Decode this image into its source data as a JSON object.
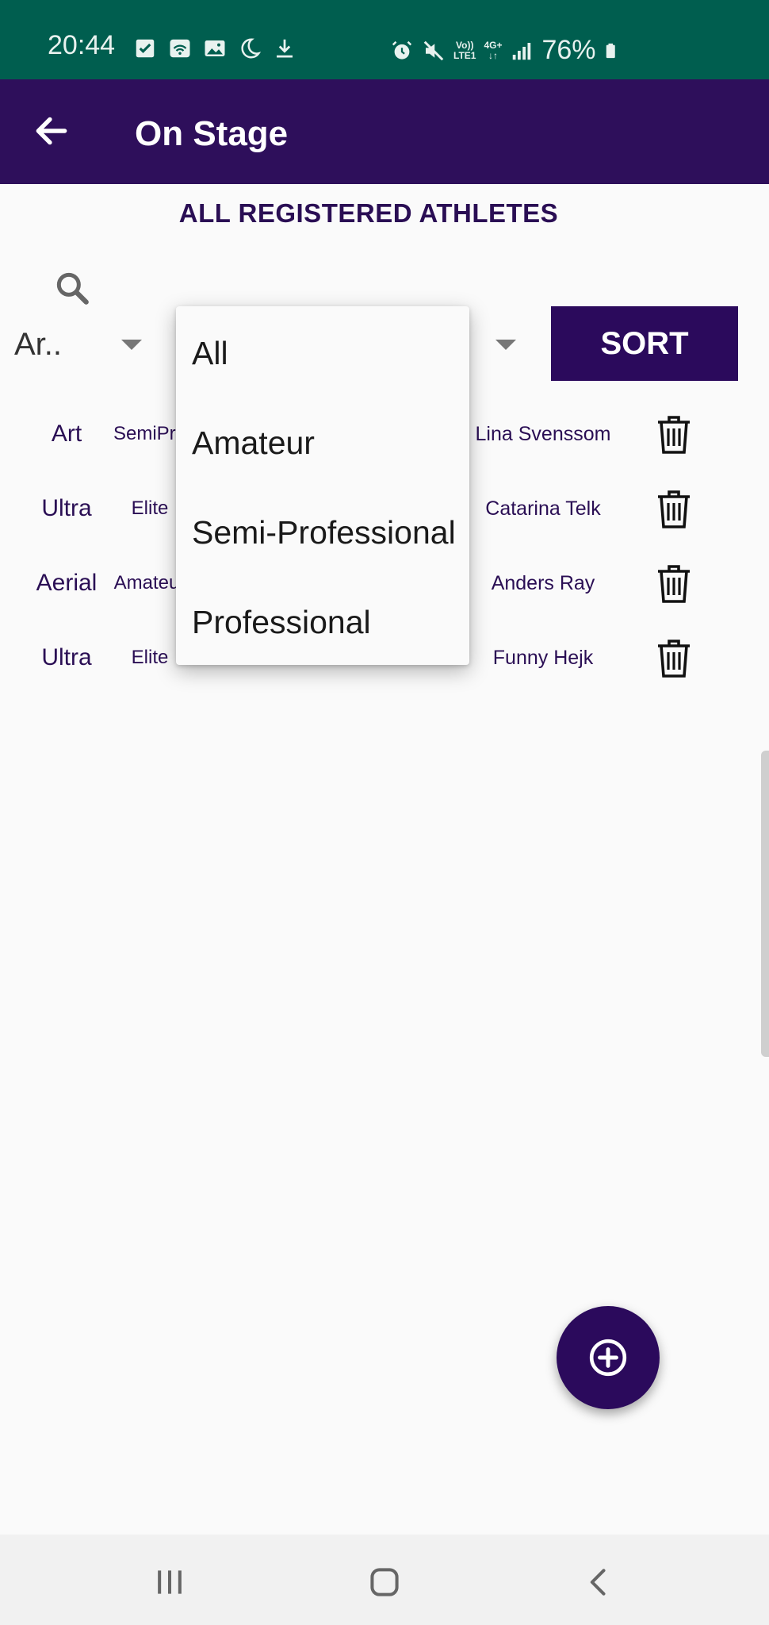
{
  "status_bar": {
    "time": "20:44",
    "network_top": "Vo))",
    "network_bottom": "LTE1",
    "data_type": "4G+",
    "battery": "76%",
    "left_icons": [
      "checkbox-icon",
      "wifi-calling-icon",
      "image-icon",
      "moon-icon",
      "download-icon"
    ],
    "right_icons": [
      "alarm-icon",
      "mute-icon",
      "signal-icon",
      "battery-icon"
    ],
    "background_color": "#005e4f"
  },
  "app_bar": {
    "title": "On Stage",
    "background_color": "#2e0f5b"
  },
  "page": {
    "heading": "ALL REGISTERED ATHLETES"
  },
  "filters": {
    "type_selected": "Ar..",
    "sort_label": "SORT"
  },
  "dropdown": {
    "options": [
      "All",
      "Amateur",
      "Semi-Professional",
      "Professional"
    ]
  },
  "athletes": [
    {
      "type": "Art",
      "level": "SemiPro",
      "level2": "",
      "name": "Lina Svenssom"
    },
    {
      "type": "Ultra",
      "level": "Elite",
      "level2": "",
      "name": "Catarina Telk"
    },
    {
      "type": "Aerial",
      "level": "Amateur",
      "level2": "",
      "name": "Anders Ray"
    },
    {
      "type": "Ultra",
      "level": "Elite",
      "level2": "Elite",
      "name": "Funny Hejk"
    }
  ],
  "colors": {
    "accent": "#2b0a5c",
    "text_accent": "#2a0e54",
    "background": "#fafafa"
  }
}
